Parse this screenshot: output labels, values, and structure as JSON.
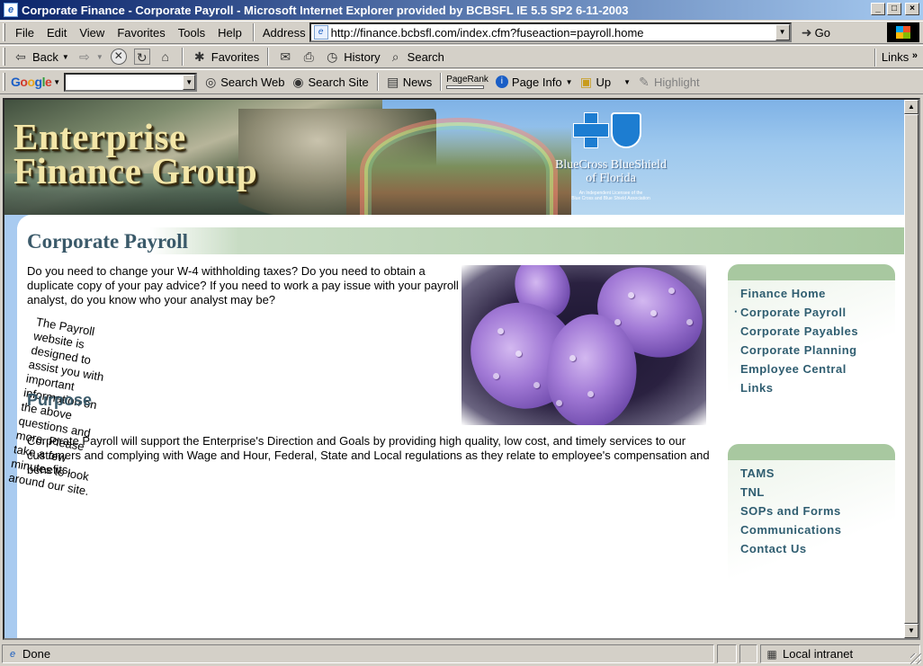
{
  "window": {
    "title": "Corporate Finance - Corporate Payroll - Microsoft Internet Explorer provided by BCBSFL IE 5.5 SP2 6-11-2003"
  },
  "menu": [
    "File",
    "Edit",
    "View",
    "Favorites",
    "Tools",
    "Help"
  ],
  "address": {
    "label": "Address",
    "url": "http://finance.bcbsfl.com/index.cfm?fuseaction=payroll.home",
    "go": "Go"
  },
  "toolbar": {
    "back": "Back",
    "favorites": "Favorites",
    "history": "History",
    "search": "Search",
    "links": "Links"
  },
  "google_bar": {
    "logo": "Google",
    "search_web": "Search Web",
    "search_site": "Search Site",
    "news": "News",
    "pagerank": "PageRank",
    "page_info": "Page Info",
    "up": "Up",
    "highlight": "Highlight"
  },
  "banner": {
    "title_line1": "Enterprise",
    "title_line2": "Finance Group",
    "bcbs_line1": "BlueCross BlueShield",
    "bcbs_line2": "of Florida",
    "bcbs_tag_line1": "An Independent Licensee of the",
    "bcbs_tag_line2": "Blue Cross and Blue Shield Association"
  },
  "content": {
    "page_title": "Corporate Payroll",
    "intro_p1": "Do you need to change your W-4 withholding taxes? Do you need to obtain a duplicate copy of your pay advice? If you need to work a pay issue with your payroll analyst, do you know who your analyst may be?",
    "intro_p2": "The Payroll website is designed to assist you with important information on the above questions and more. Please take a few minutes to look around our site.",
    "purpose_heading": "Purpose",
    "purpose_body": "Corporate Payroll will support the Enterprise's Direction and Goals by providing high quality, low cost, and timely services to our customers and complying with Wage and Hour, Federal, State and Local regulations as they relate to employee's compensation and benefits."
  },
  "nav_primary": [
    "Finance Home",
    "Corporate Payroll",
    "Corporate Payables",
    "Corporate Planning",
    "Employee Central",
    "Links"
  ],
  "nav_secondary": [
    "TAMS",
    "TNL",
    "SOPs and Forms",
    "Communications",
    "Contact Us"
  ],
  "status": {
    "text": "Done",
    "zone": "Local intranet"
  }
}
